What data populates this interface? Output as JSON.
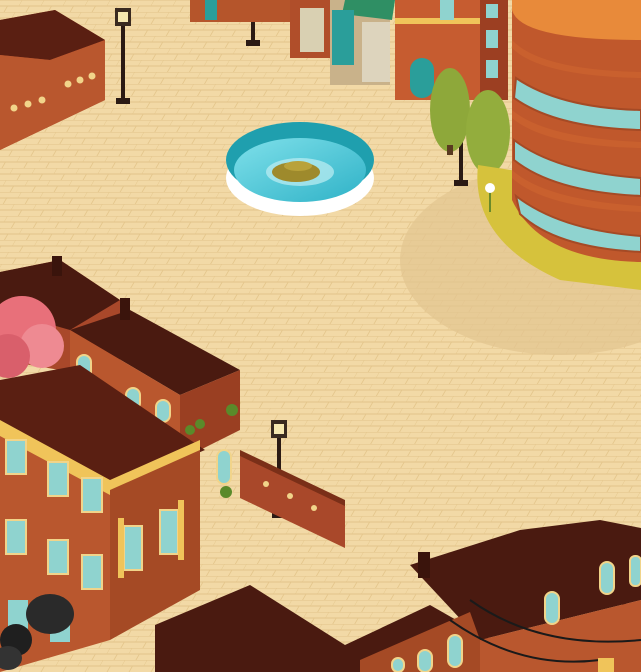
{
  "scene": {
    "palette": {
      "plaza": "#f2d9a6",
      "plaza_tile": "#e6c98f",
      "brick": "#b5552b",
      "brick_dark": "#7a2f18",
      "roof": "#4a1a10",
      "trim": "#f0c45a",
      "window": "#8fd3cf",
      "water": "#4fc9d8",
      "lawn": "#d6c23c",
      "tree": "#8ea83a",
      "blossom": "#e8707a"
    },
    "icons": {
      "fountain": "fountain-icon",
      "lamp": "street-lamp-icon",
      "tree": "pine-tree-icon",
      "trash": "trash-bag-icon"
    }
  }
}
